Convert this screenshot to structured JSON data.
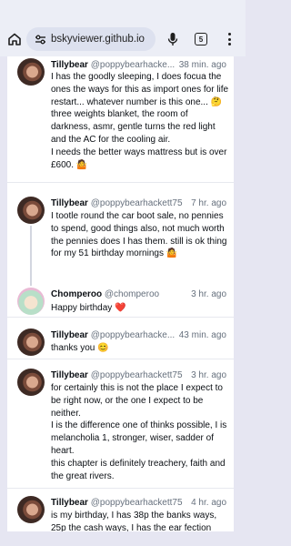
{
  "browser": {
    "url": "bskyviewer.github.io",
    "tab_count": "5",
    "icons": {
      "home": "home-icon",
      "site_settings": "tune-icon",
      "mic": "mic-icon",
      "menu": "more-vert-icon"
    }
  },
  "posts": [
    {
      "name": "Tillybear",
      "handle": "@poppybearhacke...",
      "time": "38 min. ago",
      "text": "I has the goodly sleeping, I does focua the ones the ways for this as import ones for life restart... whatever number is this one... 🤔\nthree weights blanket, the room of darkness, asmr, gentle turns the red light and the AC for the cooling air.\nI needs the better ways mattress but is over £600. 🤷"
    },
    {
      "name": "Tillybear",
      "handle": "@poppybearhackett75",
      "time": "7 hr. ago",
      "text": "I tootle round the car boot sale, no pennies to spend, good things also, not much worth the pennies does I has them. still is ok thing for my 51 birthday mornings 🤷"
    },
    {
      "name": "Chomperoo",
      "handle": "@chomperoo",
      "time": "3 hr. ago",
      "text": "Happy birthday ❤️"
    },
    {
      "name": "Tillybear",
      "handle": "@poppybearhacke...",
      "time": "43 min. ago",
      "text": "thanks you 😊"
    },
    {
      "name": "Tillybear",
      "handle": "@poppybearhackett75",
      "time": "3 hr. ago",
      "text": "for certainly this is not the place I expect to be right now, or the one I expect to be neither.\nI is the difference one of thinks possible, I is melancholia 1, stronger, wiser, sadder of heart.\nthis chapter is definitely treachery, faith and the great rivers."
    },
    {
      "name": "Tillybear",
      "handle": "@poppybearhackett75",
      "time": "4 hr. ago",
      "text": "is my birthday, I has 38p the banks ways, 25p the cash ways, I has the ear fection"
    }
  ]
}
